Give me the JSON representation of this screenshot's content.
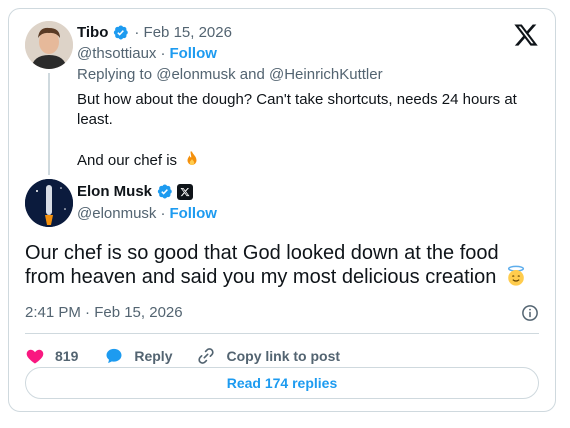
{
  "reply_tweet": {
    "author_name": "Tibo",
    "dot_date": "· Feb 15, 2026",
    "handle": "@thsottiaux",
    "separator": "·",
    "follow_label": "Follow",
    "replying_to": "Replying to @elonmusk and @HeinrichKuttler",
    "text_line1": "But how about the dough? Can't take shortcuts, needs 24 hours at least.",
    "text_line2": "And our chef is",
    "emoji": "fire-icon"
  },
  "main_tweet": {
    "author_name": "Elon Musk",
    "handle": "@elonmusk",
    "separator": "·",
    "follow_label": "Follow",
    "text": "Our chef is so good that God looked down at the food from heaven and said you my most delicious creation",
    "emoji": "smiling-face-with-halo-icon",
    "timestamp": "2:41 PM · Feb 15, 2026"
  },
  "actions": {
    "like_count": "819",
    "reply_label": "Reply",
    "copy_link_label": "Copy link to post"
  },
  "read_replies_label": "Read 174 replies",
  "colors": {
    "accent": "#1d9bf0",
    "like": "#f91880",
    "text": "#0f1419",
    "muted": "#536471",
    "border": "#cfd9de"
  }
}
